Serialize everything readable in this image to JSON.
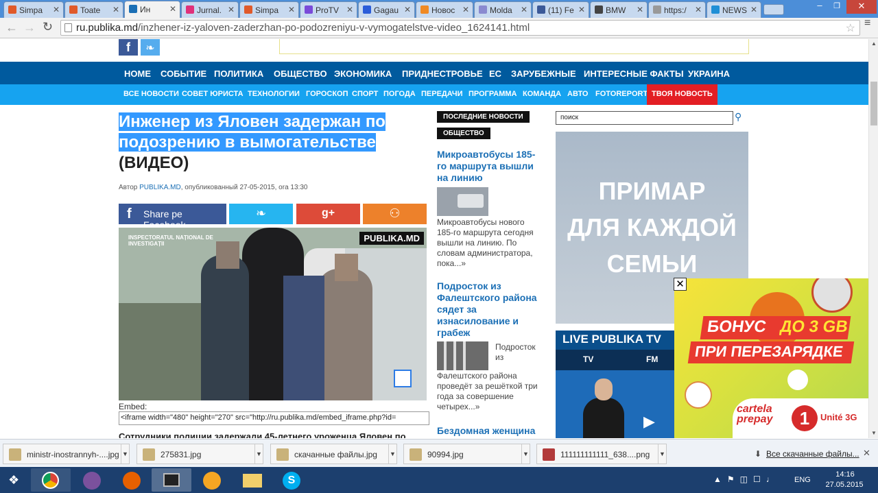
{
  "tabs": [
    {
      "label": "Simpa",
      "color": "#e05a2a"
    },
    {
      "label": "Toate",
      "color": "#e05a2a"
    },
    {
      "label": "Ин",
      "color": "#1b6fb5"
    },
    {
      "label": "Jurnal.",
      "color": "#e0307a"
    },
    {
      "label": "Simpa",
      "color": "#e05a2a"
    },
    {
      "label": "ProTV",
      "color": "#7a4ad9"
    },
    {
      "label": "Gagau",
      "color": "#2a5cd9"
    },
    {
      "label": "Новос",
      "color": "#f08a24"
    },
    {
      "label": "Molda",
      "color": "#8a8ad0"
    },
    {
      "label": "(11) Fe",
      "color": "#3b5998"
    },
    {
      "label": "BMW",
      "color": "#444"
    },
    {
      "label": "https:/",
      "color": "#999"
    },
    {
      "label": "NEWS",
      "color": "#1f8fd6"
    }
  ],
  "url": {
    "host": "ru.publika.md",
    "path": "/inzhener-iz-yaloven-zaderzhan-po-podozreniyu-v-vymogatelstve-video_1624141.html"
  },
  "nav_main": [
    "HOME",
    "СОБЫТИЕ",
    "ПОЛИТИКА",
    "ОБЩЕСТВО",
    "ЭКОНОМИКА",
    "ПРИДНЕСТРОВЬЕ",
    "ЕС",
    "ЗАРУБЕЖНЫЕ",
    "ИНТЕРЕСНЫЕ ФАКТЫ",
    "УКРАИНА"
  ],
  "nav_sub": [
    "ВСЕ НОВОСТИ",
    "СОВЕТ ЮРИСТА",
    "ТЕХНОЛОГИИ",
    "ГОРОСКОП",
    "СПОРТ",
    "ПОГОДА",
    "ПЕРЕДАЧИ",
    "ПРОГРАММА",
    "КОМАНДА",
    "АВТО",
    "FOTOREPORT",
    "ТВОЯ НОВОСТЬ"
  ],
  "article": {
    "title_line1": "Инженер из Яловен задержан по",
    "title_line2": "подозрению в вымогательстве",
    "title_line3": "(ВИДЕО)",
    "byline_prefix": "Автор ",
    "byline_author": "PUBLIKA.MD",
    "byline_suffix": ", опубликованный 27-05-2015, ora 13:30",
    "share_fb": "Share pe Facebook",
    "video_logo_left": "INSPECTORATUL NAȚIONAL DE INVESTIGAȚII",
    "video_logo_right": "PUBLIKA.MD",
    "embed_label": "Embed:",
    "embed_code": "<iframe width=\"480\" height=\"270\" src=\"http://ru.publika.md/embed_iframe.php?id=",
    "lead": "Сотрудники полиции задержали 45-летнего уроженца Яловен по"
  },
  "sidebar": {
    "tag1": "ПОСЛЕДНИЕ НОВОСТИ",
    "tag2": "ОБЩЕСТВО",
    "news1_title": "Микроавтобусы 185-го маршрута вышли на линию",
    "news1_text": "Микроавтобусы нового 185-го маршрута сегодня вышли на линию. По словам администратора, пока...»",
    "news2_title": "Подросток из Фалештского района сядет за изнасилование и грабеж",
    "news2_text_a": "Подросток",
    "news2_text_b": "из",
    "news2_text_c": "Фалештского района проведёт за решёткой три года за совершение четырех...»",
    "news3_title": "Бездомная женщина"
  },
  "right": {
    "search_placeholder": "поиск",
    "ad_line1": "ПРИМАР",
    "ad_line2": "ДЛЯ КАЖДОЙ",
    "ad_line3": "СЕМЬИ",
    "live_title": "LIVE PUBLIKA TV",
    "live_tv": "TV",
    "live_fm": "FM"
  },
  "popup": {
    "line1a": "БОНУС",
    "line1b": "ДО 3 GB",
    "line2": "ПРИ ПЕРЕЗАРЯДКЕ",
    "brand1": "cartela",
    "brand2": "prepay",
    "brand3": "Unité 3G"
  },
  "downloads": [
    {
      "name": "ministr-inostrannyh-....jpg"
    },
    {
      "name": "275831.jpg"
    },
    {
      "name": "скачанные файлы.jpg"
    },
    {
      "name": "90994.jpg"
    },
    {
      "name": "111111111111_638....png"
    }
  ],
  "downloads_all": "Все скачанные файлы...",
  "clock": {
    "time": "14:16",
    "date": "27.05.2015",
    "lang": "ENG"
  }
}
